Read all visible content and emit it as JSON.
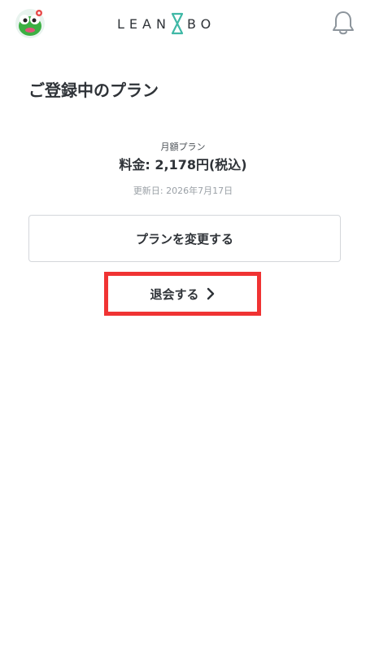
{
  "header": {
    "logo_text": "LEANBODY",
    "logo_left": "LEAN",
    "logo_right": "BO",
    "avatar_icon": "mascot-avatar-icon",
    "bell_icon": "bell-icon"
  },
  "main": {
    "page_title": "ご登録中のプラン",
    "plan_name": "月額プラン",
    "plan_price": "料金: 2,178円(税込)",
    "renew_date": "更新日: 2026年7月17日",
    "change_plan_label": "プランを変更する",
    "withdraw_label": "退会する"
  },
  "colors": {
    "highlight": "#f03333",
    "text": "#2f3338",
    "muted": "#9aa0a6",
    "accent_teal": "#3fb8a6"
  }
}
